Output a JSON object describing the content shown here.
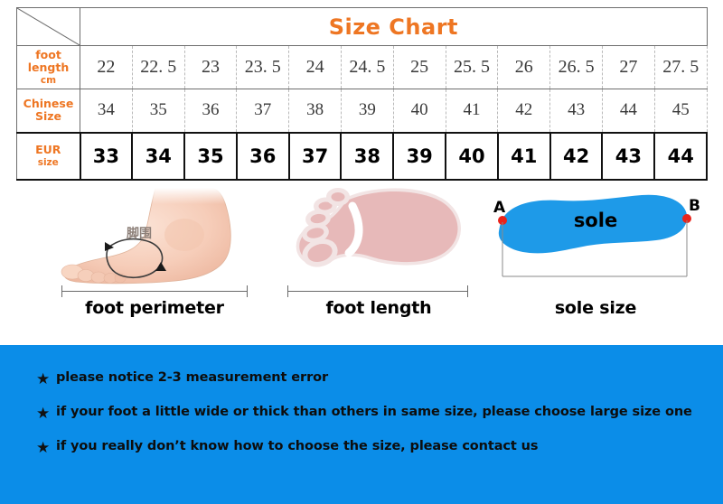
{
  "table": {
    "title": "Size Chart",
    "corner_icon": "diagonal-divider",
    "rows": [
      {
        "label_main": "foot\nlength",
        "label_line1": "foot",
        "label_line2": "length",
        "label_unit": "cm",
        "values": [
          "22",
          "22. 5",
          "23",
          "23. 5",
          "24",
          "24. 5",
          "25",
          "25. 5",
          "26",
          "26. 5",
          "27",
          "27. 5"
        ]
      },
      {
        "label_line1": "Chinese",
        "label_line2": "Size",
        "label_unit": "",
        "values": [
          "34",
          "35",
          "36",
          "37",
          "38",
          "39",
          "40",
          "41",
          "42",
          "43",
          "44",
          "45"
        ]
      },
      {
        "label_line1": "EUR",
        "label_line2": "size",
        "label_unit": "",
        "values": [
          "33",
          "34",
          "35",
          "36",
          "37",
          "38",
          "39",
          "40",
          "41",
          "42",
          "43",
          "44"
        ]
      }
    ]
  },
  "illustrations": [
    {
      "name": "foot-perimeter",
      "caption": "foot perimeter",
      "annotation": "脚围",
      "image": "foot-side-photo"
    },
    {
      "name": "foot-length",
      "caption": "foot length",
      "image": "footprint-outline"
    },
    {
      "name": "sole-size",
      "caption": "sole size",
      "inner_label": "sole",
      "point_a": "A",
      "point_b": "B",
      "image": "shoe-sole-shape"
    }
  ],
  "notices": {
    "bullet": "★",
    "items": [
      "please notice 2-3 measurement error",
      "if your foot a little wide or thick than others in same size, please choose large size one",
      "if you really don’t know how to choose the size, please contact us"
    ]
  },
  "colors": {
    "accent_orange": "#ee7623",
    "notice_blue": "#0b8de8",
    "sole_blue": "#1e9ae8",
    "point_red": "#e8241c",
    "footprint_pink": "#e7b9b9",
    "table_border": "#6e6e6e"
  }
}
